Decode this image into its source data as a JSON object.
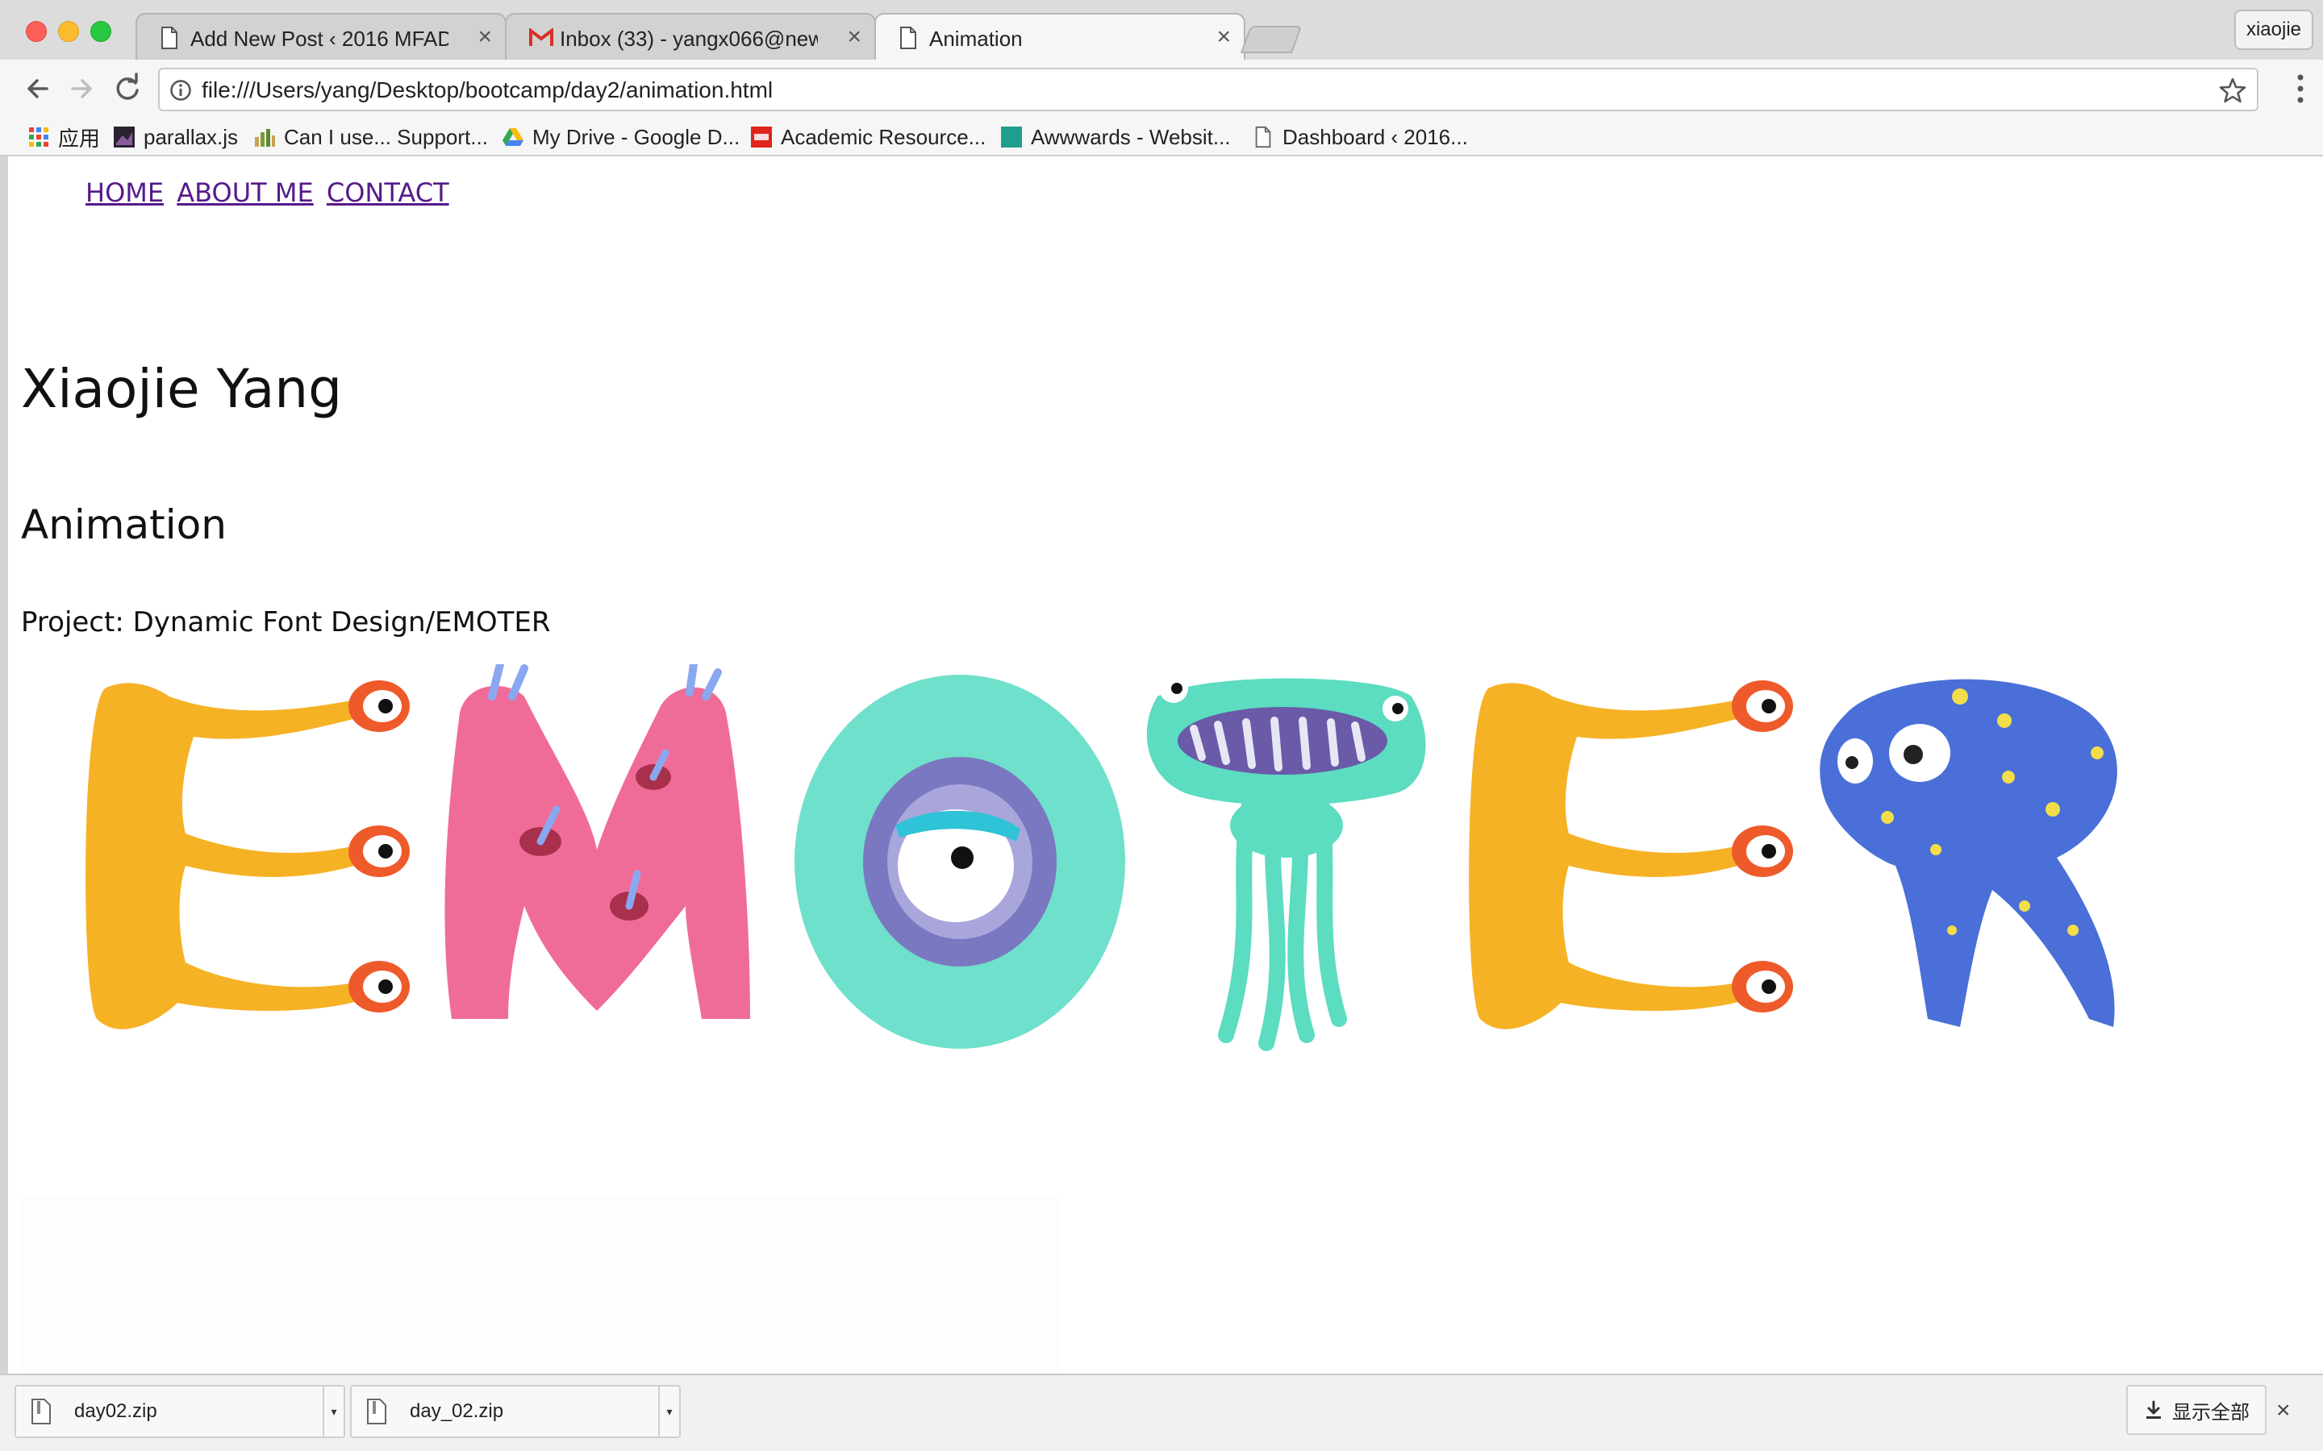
{
  "window": {
    "tabs": [
      {
        "title": "Add New Post ‹ 2016 MFADT",
        "close": "×"
      },
      {
        "title": "Inbox (33) - yangx066@newsc",
        "close": "×"
      },
      {
        "title": "Animation",
        "close": "×"
      }
    ],
    "active_tab_index": 2,
    "profile": "xiaojie"
  },
  "toolbar": {
    "url": "file:///Users/yang/Desktop/bootcamp/day2/animation.html"
  },
  "bookmarks": [
    {
      "label": "应用",
      "icon": "apps-grid-icon"
    },
    {
      "label": "parallax.js",
      "icon": "parallax-icon"
    },
    {
      "label": "Can I use... Support...",
      "icon": "caniuse-icon"
    },
    {
      "label": "My Drive - Google D...",
      "icon": "google-drive-icon"
    },
    {
      "label": "Academic Resource...",
      "icon": "new-badge-icon"
    },
    {
      "label": "Awwwards - Websit...",
      "icon": "awwwards-icon"
    },
    {
      "label": "Dashboard ‹ 2016...",
      "icon": "page-icon"
    }
  ],
  "page": {
    "nav": [
      "HOME",
      "ABOUT ME",
      "CONTACT"
    ],
    "name": "Xiaojie Yang",
    "section": "Animation",
    "project": "Project: Dynamic Font Design/EMOTER",
    "artwork_letters": [
      "E",
      "M",
      "O",
      "T",
      "E",
      "R"
    ]
  },
  "downloads": {
    "items": [
      {
        "name": "day02.zip",
        "arrow": "▾"
      },
      {
        "name": "day_02.zip",
        "arrow": "▾"
      }
    ],
    "show_all": "显示全部",
    "close": "×"
  },
  "colors": {
    "link": "#551a8b",
    "letter_e": "#f5b225",
    "letter_m": "#f06c98",
    "letter_o": "#6fe0cb",
    "letter_t": "#5cdcc0",
    "letter_r": "#4a6fd8"
  }
}
